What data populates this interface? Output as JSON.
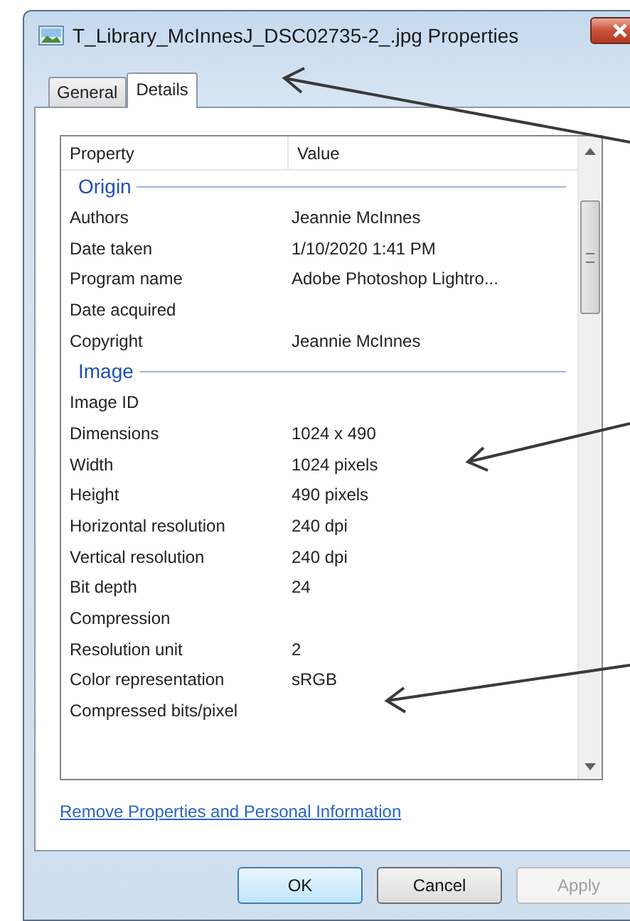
{
  "window": {
    "title": "T_Library_McInnesJ_DSC02735-2_.jpg Properties"
  },
  "tabs": [
    {
      "label": "General",
      "selected": false
    },
    {
      "label": "Details",
      "selected": true
    }
  ],
  "table": {
    "columns": [
      "Property",
      "Value"
    ],
    "groups": [
      {
        "heading": "Origin",
        "rows": [
          {
            "property": "Authors",
            "value": "Jeannie McInnes"
          },
          {
            "property": "Date taken",
            "value": "1/10/2020 1:41 PM"
          },
          {
            "property": "Program name",
            "value": "Adobe Photoshop Lightro..."
          },
          {
            "property": "Date acquired"
          },
          {
            "property": "Copyright",
            "value": "Jeannie McInnes"
          }
        ]
      },
      {
        "heading": "Image",
        "rows": [
          {
            "property": "Image ID"
          },
          {
            "property": "Dimensions",
            "value": "1024 x 490"
          },
          {
            "property": "Width",
            "value": "1024 pixels"
          },
          {
            "property": "Height",
            "value": "490 pixels"
          },
          {
            "property": "Horizontal resolution",
            "value": "240 dpi"
          },
          {
            "property": "Vertical resolution",
            "value": "240 dpi"
          },
          {
            "property": "Bit depth",
            "value": "24"
          },
          {
            "property": "Compression"
          },
          {
            "property": "Resolution unit",
            "value": "2"
          },
          {
            "property": "Color representation",
            "value": "sRGB"
          },
          {
            "property": "Compressed bits/pixel"
          }
        ]
      }
    ]
  },
  "link": "Remove Properties and Personal Information",
  "buttons": [
    {
      "label": "OK",
      "disabled": false,
      "default": true
    },
    {
      "label": "Cancel",
      "disabled": false,
      "default": false
    },
    {
      "label": "Apply",
      "disabled": true,
      "default": false
    }
  ]
}
